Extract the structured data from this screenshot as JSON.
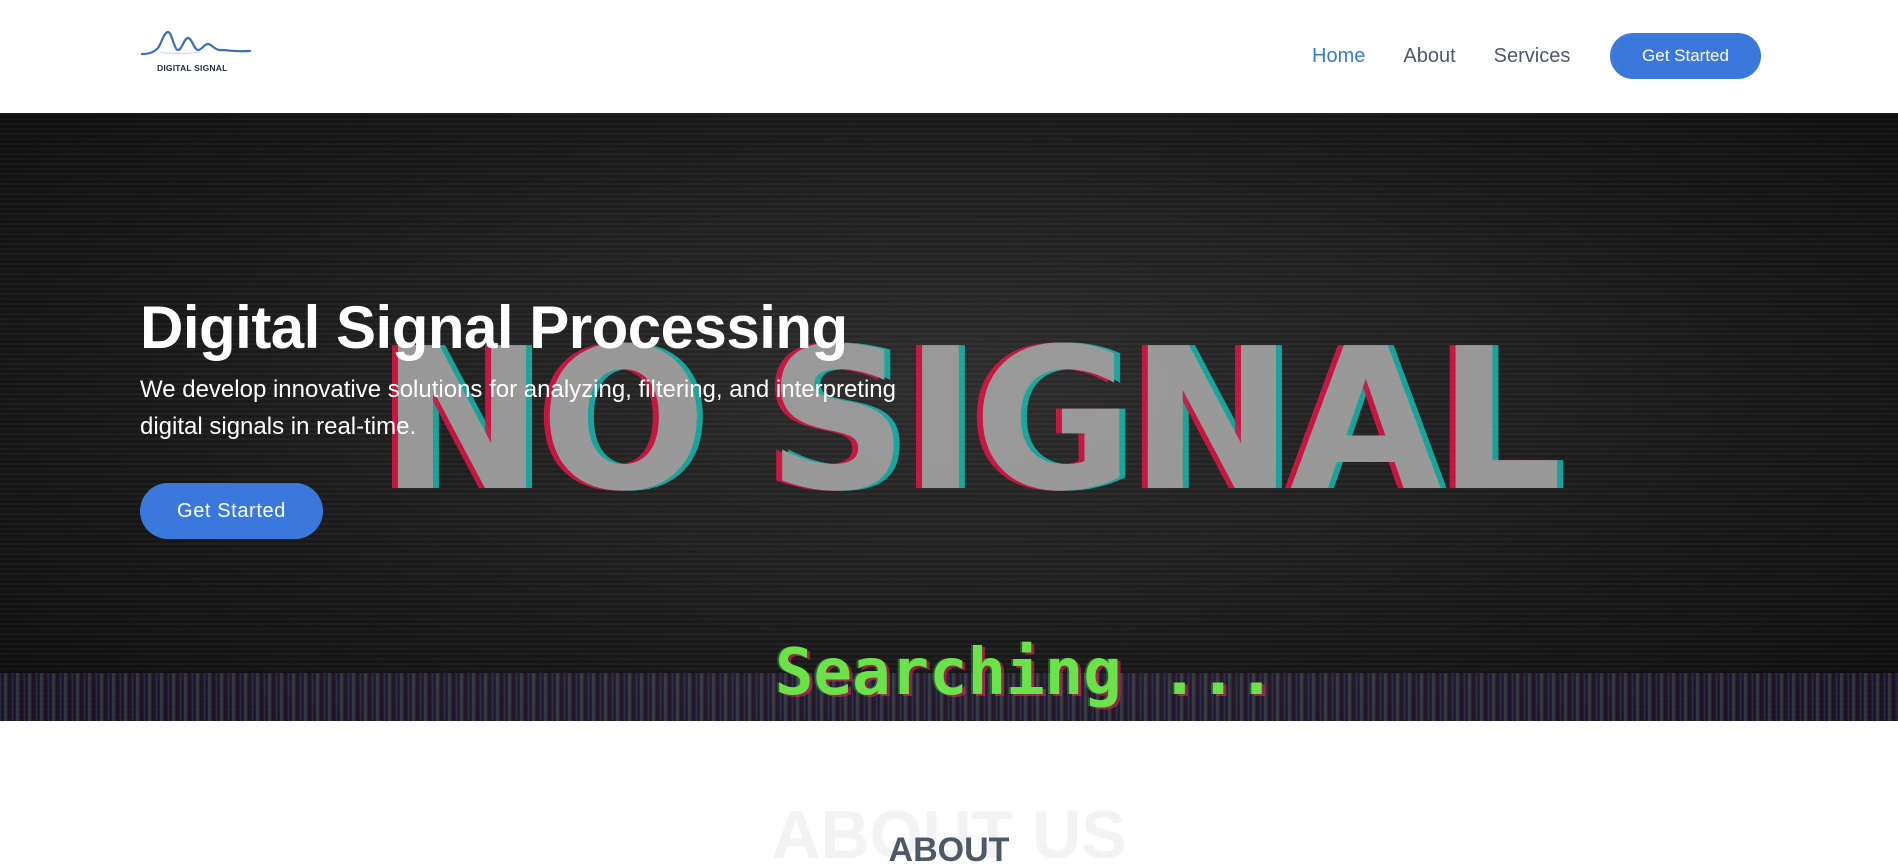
{
  "header": {
    "logo_text": "DIGITAL SIGNAL",
    "nav": [
      {
        "label": "Home",
        "active": true
      },
      {
        "label": "About",
        "active": false
      },
      {
        "label": "Services",
        "active": false
      }
    ],
    "cta_label": "Get Started"
  },
  "hero": {
    "background_text": "NO SIGNAL",
    "status_text": "Searching ...",
    "title": "Digital Signal Processing",
    "description": "We develop innovative solutions for analyzing, filtering, and interpreting digital signals in real-time.",
    "cta_label": "Get Started"
  },
  "about": {
    "background_title": "ABOUT US",
    "title": "ABOUT"
  },
  "colors": {
    "accent": "#3a78dc",
    "nav_active": "#3a7bd5",
    "nav_text": "#4d5968",
    "signal_green": "#6be24a"
  }
}
